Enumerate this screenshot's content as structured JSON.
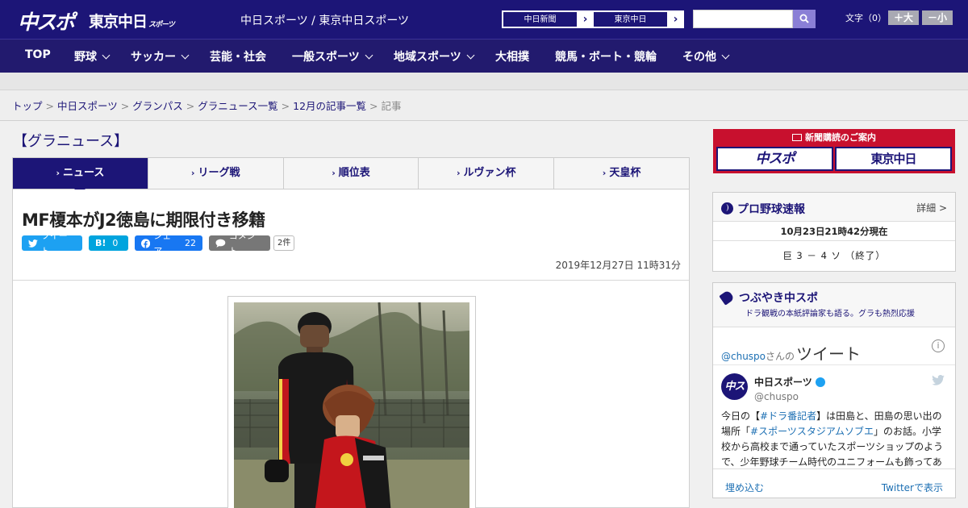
{
  "header": {
    "logo_chuspo": "中スポ",
    "logo_tokyo": "東京中日",
    "logo_tokyo_sub": "スポーツ",
    "site_name": "中日スポーツ / 東京中日スポーツ",
    "ext_links": [
      "中日新聞",
      "東京中日"
    ],
    "search_placeholder": "",
    "font_label": "文字（0）",
    "font_bigger": "＋大",
    "font_smaller": "－小"
  },
  "nav": {
    "items": [
      "TOP",
      "野球",
      "サッカー",
      "芸能・社会",
      "一般スポーツ",
      "地域スポーツ",
      "大相撲",
      "競馬・ボート・競輪",
      "その他"
    ]
  },
  "breadcrumb": {
    "items": [
      "トップ",
      "中日スポーツ",
      "グランパス",
      "グラニュース一覧",
      "12月の記事一覧"
    ],
    "current": "記事",
    "separator": ">"
  },
  "main": {
    "section_title": "【グラニュース】",
    "tabs": [
      {
        "label": "ニュース",
        "active": true
      },
      {
        "label": "リーグ戦",
        "active": false
      },
      {
        "label": "順位表",
        "active": false
      },
      {
        "label": "ルヴァン杯",
        "active": false
      },
      {
        "label": "天皇杯",
        "active": false
      }
    ],
    "tab_mark": "›",
    "headline": "MF榎本がJ2徳島に期限付き移籍",
    "share": {
      "tweet": "ツイート",
      "hatena": "B!",
      "hatena_count": "0",
      "facebook": "シェア",
      "facebook_count": "22",
      "comment": "コメント",
      "comment_count": "2件"
    },
    "date": "2019年12月27日 11時31分"
  },
  "sidebar": {
    "subscribe_title": "新聞購読のご案内",
    "subscribe_logos": [
      "中スポ",
      "東京中日"
    ],
    "baseball": {
      "title": "プロ野球速報",
      "detail": "詳細 >",
      "time": "10月23日21時42分現在",
      "score": "巨 3 － 4 ソ （終了）"
    },
    "tweets": {
      "title": "つぶやき中スポ",
      "subtitle": "ドラ観戦の本紙評論家も語る。グラも熱烈応援",
      "handle_prefix": "@chuspo",
      "san": "さんの",
      "tweet_word": "ツイート",
      "info": "i",
      "avatar_text": "中スポ",
      "account_name": "中日スポーツ",
      "account_handle": "@chuspo",
      "text_1": "今日の【",
      "text_link_1": "#ドラ番記者",
      "text_2": "】は田島と、田島の思い出の場所「",
      "text_link_2": "#スポーツスタジアムソブエ",
      "text_3": "」のお話。小学校から高校まで通っていたスポーツショップのようで、少年野球チーム時代のユニフォームも飾ってあ",
      "embed": "埋め込む",
      "view_on_twitter": "Twitterで表示"
    }
  },
  "colors": {
    "brand": "#1c1577",
    "nav_bg": "#221a6e",
    "subscribe_red": "#c8102e",
    "twitter_blue": "#1da1f2",
    "facebook_blue": "#1877f2"
  }
}
